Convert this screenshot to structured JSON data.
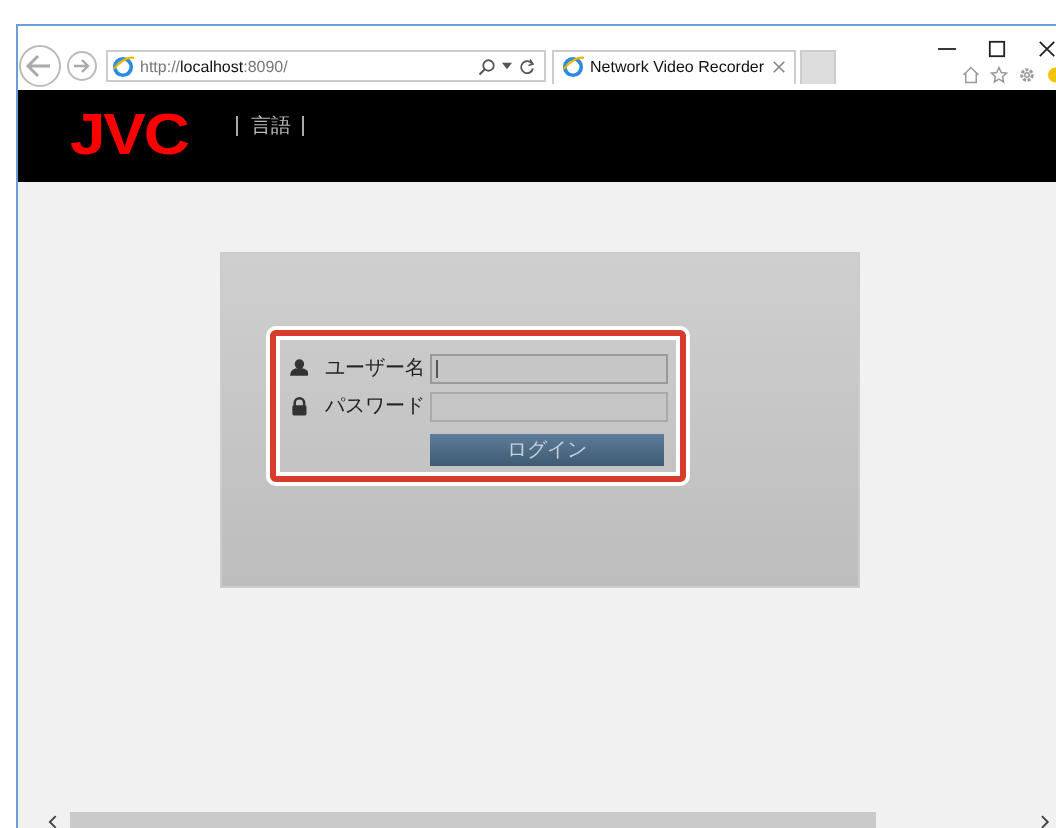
{
  "browser": {
    "address": {
      "prefix": "http://",
      "host": "localhost",
      "suffix": ":8090/"
    },
    "tab": {
      "title": "Network Video Recorder"
    }
  },
  "header": {
    "logo": "JVC",
    "menu": [
      "言語"
    ]
  },
  "login": {
    "fields": [
      {
        "kind": "user",
        "label": "ユーザー名",
        "focused": true
      },
      {
        "kind": "password",
        "label": "パスワード",
        "focused": false
      }
    ],
    "button": "ログイン",
    "highlighted": true
  }
}
